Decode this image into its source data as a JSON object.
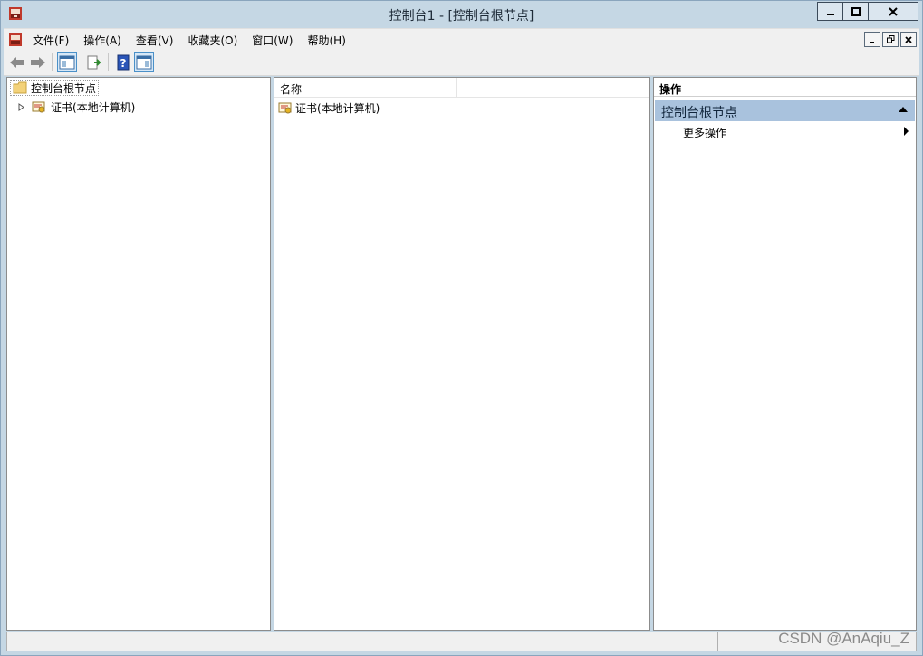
{
  "window": {
    "title": "控制台1 - [控制台根节点]",
    "minimize_icon": "minimize-icon",
    "maximize_icon": "maximize-icon",
    "close_icon": "close-icon"
  },
  "menu": {
    "items": [
      "文件(F)",
      "操作(A)",
      "查看(V)",
      "收藏夹(O)",
      "窗口(W)",
      "帮助(H)"
    ]
  },
  "toolbar": {
    "icons": [
      "back-arrow-icon",
      "forward-arrow-icon",
      "show-hide-console-tree-icon",
      "export-list-icon",
      "help-icon",
      "show-hide-action-pane-icon"
    ]
  },
  "tree": {
    "root_label": "控制台根节点",
    "child_label": "证书(本地计算机)"
  },
  "list": {
    "column_name": "名称",
    "rows": [
      "证书(本地计算机)"
    ]
  },
  "actions": {
    "header": "操作",
    "section_title": "控制台根节点",
    "more_actions": "更多操作"
  },
  "watermark": "CSDN @AnAqiu_Z",
  "colors": {
    "title_bg": "#c5d7e4",
    "section_bg": "#a9c2dd",
    "pane_bg": "#ffffff"
  }
}
